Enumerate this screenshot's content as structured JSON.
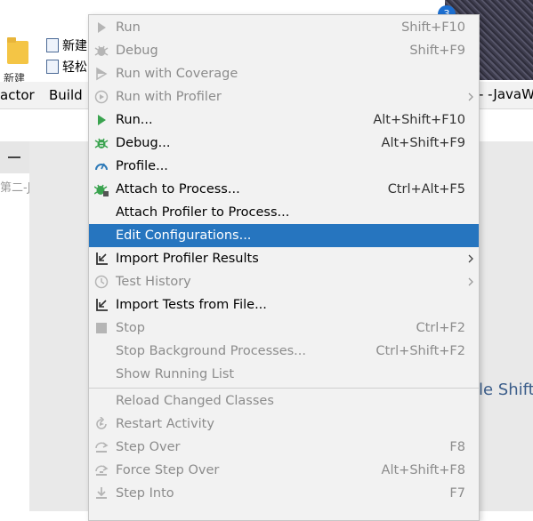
{
  "background": {
    "badge": "3",
    "folder_label": "新建",
    "ribbon_buttons": [
      "新建",
      "轻松"
    ],
    "menubar": {
      "factor": "actor",
      "build": "Build"
    },
    "project_title": "- -JavaWe",
    "tab_text": "第二-Ja",
    "editor_hint": "le Shift"
  },
  "menu": {
    "items": [
      {
        "label": "Run",
        "shortcut": "Shift+F10",
        "state": "disabled",
        "icon": "run-icon"
      },
      {
        "label": "Debug",
        "shortcut": "Shift+F9",
        "state": "disabled",
        "icon": "debug-icon"
      },
      {
        "label": "Run with Coverage",
        "shortcut": "",
        "state": "disabled",
        "icon": "coverage-icon"
      },
      {
        "label": "Run with Profiler",
        "shortcut": "",
        "state": "disabled",
        "icon": "profiler-icon",
        "submenu": true
      },
      {
        "label": "Run...",
        "shortcut": "Alt+Shift+F10",
        "state": "enabled",
        "icon": "run-icon"
      },
      {
        "label": "Debug...",
        "shortcut": "Alt+Shift+F9",
        "state": "enabled",
        "icon": "debug-icon"
      },
      {
        "label": "Profile...",
        "shortcut": "",
        "state": "enabled",
        "icon": "profile-gauge-icon"
      },
      {
        "label": "Attach to Process...",
        "shortcut": "Ctrl+Alt+F5",
        "state": "enabled",
        "icon": "attach-debug-icon"
      },
      {
        "label": "Attach Profiler to Process...",
        "shortcut": "",
        "state": "enabled",
        "icon": ""
      },
      {
        "label": "Edit Configurations...",
        "shortcut": "",
        "state": "selected",
        "icon": ""
      },
      {
        "label": "Import Profiler Results",
        "shortcut": "",
        "state": "enabled",
        "icon": "import-icon",
        "submenu": true
      },
      {
        "label": "Test History",
        "shortcut": "",
        "state": "disabled",
        "icon": "history-clock-icon",
        "submenu": true
      },
      {
        "label": "Import Tests from File...",
        "shortcut": "",
        "state": "enabled",
        "icon": "import-icon"
      },
      {
        "label": "Stop",
        "shortcut": "Ctrl+F2",
        "state": "disabled",
        "icon": "stop-icon"
      },
      {
        "label": "Stop Background Processes...",
        "shortcut": "Ctrl+Shift+F2",
        "state": "disabled",
        "icon": ""
      },
      {
        "label": "Show Running List",
        "shortcut": "",
        "state": "disabled",
        "icon": ""
      },
      {
        "label": "Reload Changed Classes",
        "shortcut": "",
        "state": "disabled",
        "icon": ""
      },
      {
        "label": "Restart Activity",
        "shortcut": "",
        "state": "disabled",
        "icon": "restart-activity-icon"
      },
      {
        "label": "Step Over",
        "shortcut": "F8",
        "state": "disabled",
        "icon": "step-over-icon"
      },
      {
        "label": "Force Step Over",
        "shortcut": "Alt+Shift+F8",
        "state": "disabled",
        "icon": "force-step-over-icon"
      },
      {
        "label": "Step Into",
        "shortcut": "F7",
        "state": "disabled",
        "icon": "step-into-icon"
      }
    ]
  },
  "colors": {
    "selection": "#2675bf",
    "run_green": "#3aa34f",
    "disabled_text": "#8c8c8c",
    "profile_blue": "#2e7ab8"
  }
}
